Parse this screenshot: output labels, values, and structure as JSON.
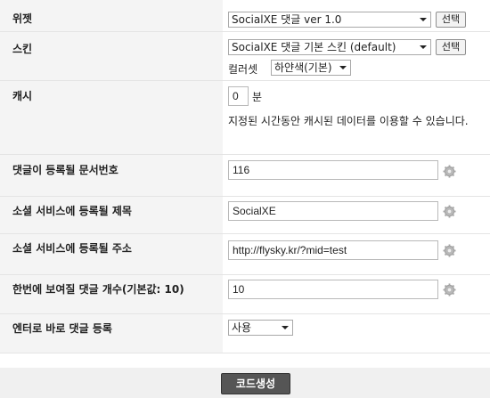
{
  "rows": {
    "widget": {
      "label": "위젯",
      "select_value": "SocialXE 댓글 ver 1.0",
      "button": "선택"
    },
    "skin": {
      "label": "스킨",
      "select_value": "SocialXE 댓글 기본 스킨 (default)",
      "button": "선택",
      "colorset_label": "컬러셋",
      "colorset_value": "하얀색(기본)"
    },
    "cache": {
      "label": "캐시",
      "value": "0",
      "unit": "분",
      "description": "지정된 시간동안 캐시된 데이터를 이용할 수 있습니다."
    },
    "document_srl": {
      "label": "댓글이 등록될 문서번호",
      "value": "116"
    },
    "title": {
      "label": "소셜 서비스에 등록될 제목",
      "value": "SocialXE"
    },
    "url": {
      "label": "소셜 서비스에 등록될 주소",
      "value": "http://flysky.kr/?mid=test"
    },
    "list_count": {
      "label": "한번에 보여질 댓글 개수(기본값: 10)",
      "value": "10"
    },
    "enter_send": {
      "label": "엔터로 바로 댓글 등록",
      "select_value": "사용"
    }
  },
  "footer": {
    "generate_button": "코드생성"
  },
  "icons": {
    "gear": "gear-icon"
  }
}
